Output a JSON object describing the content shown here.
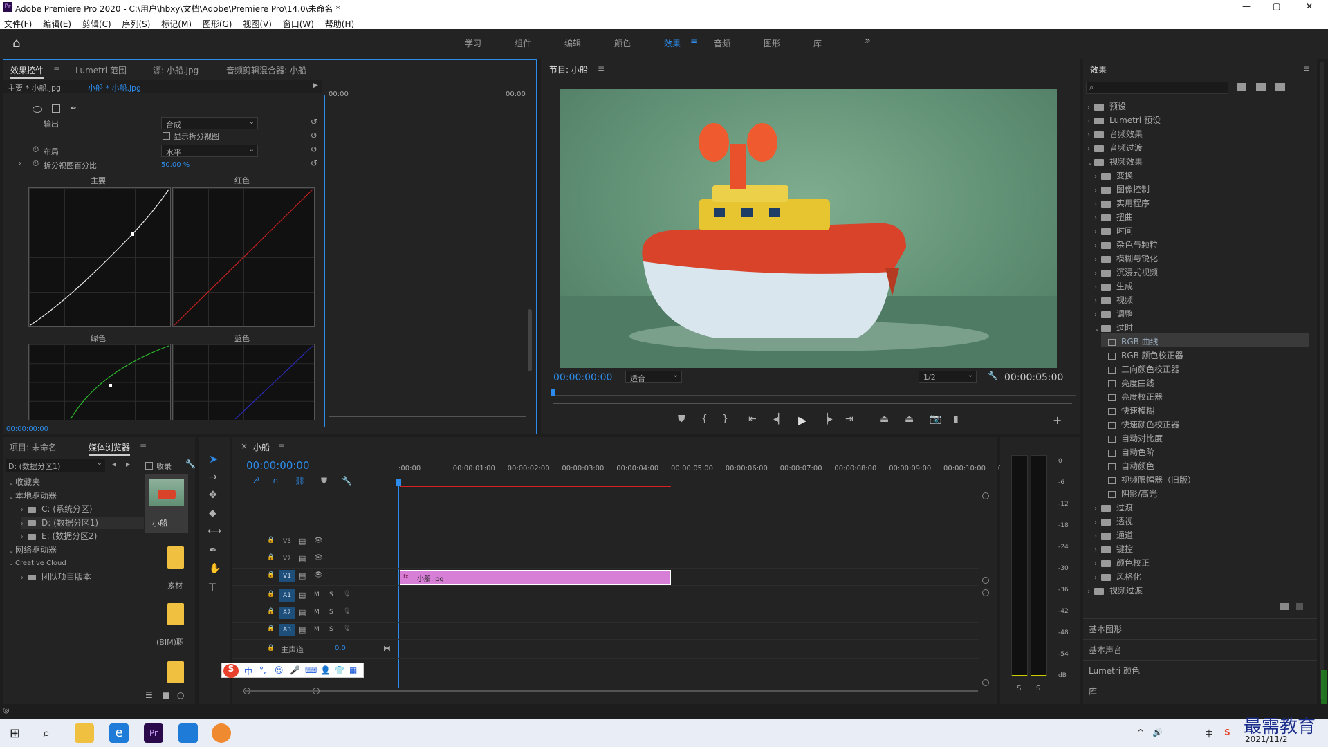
{
  "window": {
    "title": "Adobe Premiere Pro 2020 - C:\\用户\\hbxy\\文档\\Adobe\\Premiere Pro\\14.0\\未命名 *",
    "controls": [
      "—",
      "▢",
      "✕"
    ]
  },
  "menu": [
    "文件(F)",
    "编辑(E)",
    "剪辑(C)",
    "序列(S)",
    "标记(M)",
    "图形(G)",
    "视图(V)",
    "窗口(W)",
    "帮助(H)"
  ],
  "workspaces": [
    "学习",
    "组件",
    "编辑",
    "颜色",
    "效果",
    "音频",
    "图形",
    "库"
  ],
  "active_workspace": "效果",
  "effect_controls": {
    "tabs": [
      "效果控件",
      "Lumetri 范围",
      "源: 小船.jpg",
      "音频剪辑混合器: 小船"
    ],
    "clip_path": "主要 * 小船.jpg",
    "clip_active": "小船 * 小船.jpg",
    "tc_start": "00:00",
    "tc_end": "00:00",
    "output_label": "输出",
    "output_value": "合成",
    "split_label": "显示拆分视图",
    "layout_label": "布局",
    "layout_value": "水平",
    "split_pct_label": "拆分视图百分比",
    "split_pct_value": "50.00 %",
    "curve_labels": [
      "主要",
      "红色",
      "绿色",
      "蓝色"
    ],
    "timecode": "00:00:00:00"
  },
  "program": {
    "title": "节目: 小船",
    "timecode": "00:00:00:00",
    "fit": "适合",
    "quality": "1/2",
    "duration": "00:00:05:00"
  },
  "project": {
    "tabs": [
      "项目: 未命名",
      "媒体浏览器"
    ],
    "drive": "D: (数据分区1)",
    "collect_label": "收录",
    "tree": [
      {
        "label": "收藏夹",
        "level": 0
      },
      {
        "label": "本地驱动器",
        "level": 0
      },
      {
        "label": "C: (系统分区)",
        "level": 1
      },
      {
        "label": "D: (数据分区1)",
        "level": 1
      },
      {
        "label": "E: (数据分区2)",
        "level": 1
      },
      {
        "label": "网络驱动器",
        "level": 0
      },
      {
        "label": "Creative Cloud",
        "level": 0
      },
      {
        "label": "团队项目版本",
        "level": 1
      }
    ],
    "thumbs": [
      "小船",
      "素材",
      "(BIM)职"
    ]
  },
  "timeline": {
    "title": "小船",
    "timecode": "00:00:00:00",
    "ruler": [
      ":00:00",
      "00:00:01:00",
      "00:00:02:00",
      "00:00:03:00",
      "00:00:04:00",
      "00:00:05:00",
      "00:00:06:00",
      "00:00:07:00",
      "00:00:08:00",
      "00:00:09:00",
      "00:00:10:00",
      "0"
    ],
    "video_tracks": [
      "V3",
      "V2",
      "V1"
    ],
    "audio_tracks": [
      "A1",
      "A2",
      "A3"
    ],
    "audio_flags": [
      "M",
      "S"
    ],
    "master_label": "主声道",
    "master_value": "0.0",
    "clip_name": "小船.jpg"
  },
  "meter": {
    "scale": [
      "0",
      "-6",
      "-12",
      "-18",
      "-24",
      "-30",
      "-36",
      "-42",
      "-48",
      "-54",
      "dB"
    ],
    "solo": [
      "S",
      "S"
    ]
  },
  "effects": {
    "title": "效果",
    "tree": [
      {
        "label": "预设",
        "indent": 0,
        "type": "folder",
        "arrow": "›"
      },
      {
        "label": "Lumetri 预设",
        "indent": 0,
        "type": "folder",
        "arrow": "›"
      },
      {
        "label": "音频效果",
        "indent": 0,
        "type": "folder",
        "arrow": "›"
      },
      {
        "label": "音频过渡",
        "indent": 0,
        "type": "folder",
        "arrow": "›"
      },
      {
        "label": "视频效果",
        "indent": 0,
        "type": "folder",
        "arrow": "⌄"
      },
      {
        "label": "变换",
        "indent": 1,
        "type": "folder",
        "arrow": "›"
      },
      {
        "label": "图像控制",
        "indent": 1,
        "type": "folder",
        "arrow": "›"
      },
      {
        "label": "实用程序",
        "indent": 1,
        "type": "folder",
        "arrow": "›"
      },
      {
        "label": "扭曲",
        "indent": 1,
        "type": "folder",
        "arrow": "›"
      },
      {
        "label": "时间",
        "indent": 1,
        "type": "folder",
        "arrow": "›"
      },
      {
        "label": "杂色与颗粒",
        "indent": 1,
        "type": "folder",
        "arrow": "›"
      },
      {
        "label": "模糊与锐化",
        "indent": 1,
        "type": "folder",
        "arrow": "›"
      },
      {
        "label": "沉浸式视频",
        "indent": 1,
        "type": "folder",
        "arrow": "›"
      },
      {
        "label": "生成",
        "indent": 1,
        "type": "folder",
        "arrow": "›"
      },
      {
        "label": "视频",
        "indent": 1,
        "type": "folder",
        "arrow": "›"
      },
      {
        "label": "调整",
        "indent": 1,
        "type": "folder",
        "arrow": "›"
      },
      {
        "label": "过时",
        "indent": 1,
        "type": "folder",
        "arrow": "⌄"
      },
      {
        "label": "RGB 曲线",
        "indent": 2,
        "type": "preset",
        "arrow": "",
        "selected": true
      },
      {
        "label": "RGB 颜色校正器",
        "indent": 2,
        "type": "preset",
        "arrow": ""
      },
      {
        "label": "三向颜色校正器",
        "indent": 2,
        "type": "preset",
        "arrow": ""
      },
      {
        "label": "亮度曲线",
        "indent": 2,
        "type": "preset",
        "arrow": ""
      },
      {
        "label": "亮度校正器",
        "indent": 2,
        "type": "preset",
        "arrow": ""
      },
      {
        "label": "快速模糊",
        "indent": 2,
        "type": "preset",
        "arrow": ""
      },
      {
        "label": "快速颜色校正器",
        "indent": 2,
        "type": "preset",
        "arrow": ""
      },
      {
        "label": "自动对比度",
        "indent": 2,
        "type": "preset",
        "arrow": ""
      },
      {
        "label": "自动色阶",
        "indent": 2,
        "type": "preset",
        "arrow": ""
      },
      {
        "label": "自动颜色",
        "indent": 2,
        "type": "preset",
        "arrow": ""
      },
      {
        "label": "视频限幅器（旧版）",
        "indent": 2,
        "type": "preset",
        "arrow": ""
      },
      {
        "label": "阴影/高光",
        "indent": 2,
        "type": "preset",
        "arrow": ""
      },
      {
        "label": "过渡",
        "indent": 1,
        "type": "folder",
        "arrow": "›"
      },
      {
        "label": "透视",
        "indent": 1,
        "type": "folder",
        "arrow": "›"
      },
      {
        "label": "通道",
        "indent": 1,
        "type": "folder",
        "arrow": "›"
      },
      {
        "label": "键控",
        "indent": 1,
        "type": "folder",
        "arrow": "›"
      },
      {
        "label": "颜色校正",
        "indent": 1,
        "type": "folder",
        "arrow": "›"
      },
      {
        "label": "风格化",
        "indent": 1,
        "type": "folder",
        "arrow": "›"
      },
      {
        "label": "视频过渡",
        "indent": 0,
        "type": "folder",
        "arrow": "›"
      }
    ],
    "sections": [
      "基本图形",
      "基本声音",
      "Lumetri 颜色",
      "库"
    ]
  },
  "ime": {
    "items": [
      "中",
      "°,",
      "☺",
      "🎤",
      "⌨",
      "👤",
      "👕",
      "▦"
    ]
  },
  "taskbar": {
    "date": "2021/11/2",
    "tray": [
      "^",
      "🔊",
      "中",
      "S"
    ],
    "watermark": "最需教育"
  }
}
